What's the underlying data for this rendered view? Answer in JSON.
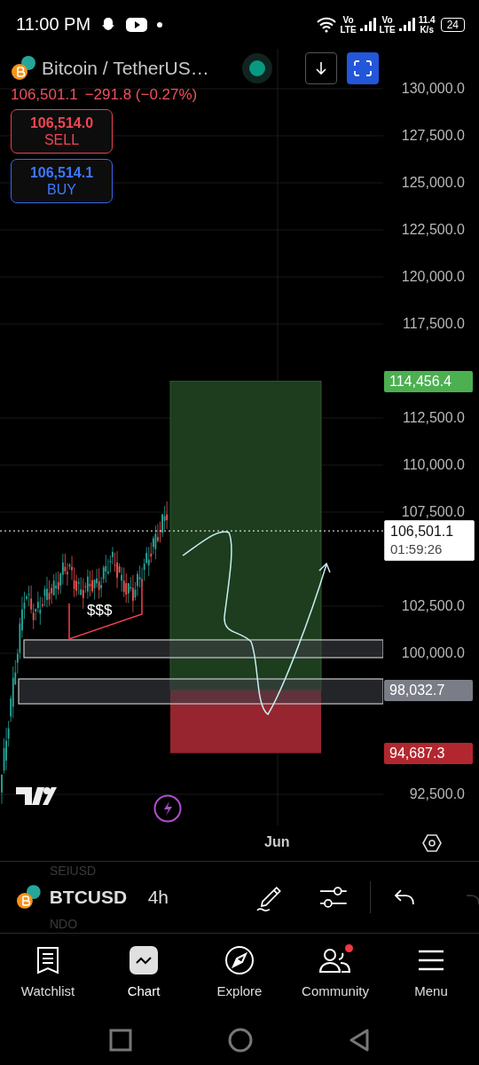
{
  "status_bar": {
    "time": "11:00 PM",
    "sims": [
      {
        "top": "Vo",
        "bottom": "LTE"
      },
      {
        "top": "Vo",
        "bottom": "LTE"
      }
    ],
    "speed": "11.4",
    "speed_unit": "K/s",
    "battery": "24"
  },
  "header": {
    "symbol": "Bitcoin / TetherUS…",
    "price": "106,501.1",
    "change": "−291.8 (−0.27%)",
    "live": true
  },
  "order_buttons": [
    {
      "kind": "sell",
      "price": "106,514.0",
      "label": "SELL"
    },
    {
      "kind": "buy",
      "price": "106,514.1",
      "label": "BUY"
    }
  ],
  "chart": {
    "price_axis": [
      "130,000.0",
      "127,500.0",
      "125,000.0",
      "122,500.0",
      "120,000.0",
      "117,500.0",
      "112,500.0",
      "110,000.0",
      "107,500.0",
      "102,500.0",
      "100,000.0",
      "92,500.0"
    ],
    "price_tags": [
      {
        "kind": "target",
        "text": "114,456.4"
      },
      {
        "kind": "current",
        "text": "106,501.1",
        "countdown": "01:59:26"
      },
      {
        "kind": "entry",
        "text": "98,032.7"
      },
      {
        "kind": "stop",
        "text": "94,687.3"
      }
    ],
    "annotation": "$$$",
    "time_axis": "Jun"
  },
  "toolbar": {
    "symbol_above": "SEIUSD",
    "symbol": "BTCUSD",
    "symbol_below": "NDO",
    "interval": "4h"
  },
  "nav": {
    "items": [
      {
        "label": "Watchlist",
        "selected": false,
        "badge": false
      },
      {
        "label": "Chart",
        "selected": true,
        "badge": false
      },
      {
        "label": "Explore",
        "selected": false,
        "badge": false
      },
      {
        "label": "Community",
        "selected": false,
        "badge": true
      },
      {
        "label": "Menu",
        "selected": false,
        "badge": false
      }
    ]
  }
}
